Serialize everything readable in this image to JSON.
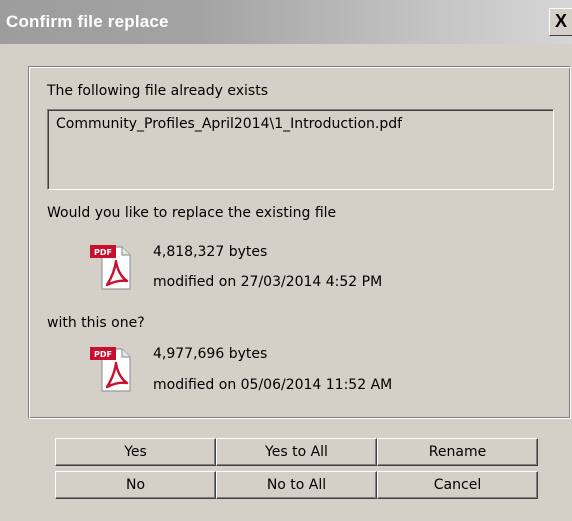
{
  "window": {
    "title": "Confirm file replace",
    "close_glyph": "X"
  },
  "message": {
    "exists_label": "The following file already exists",
    "file_path": "Community_Profiles_April2014\\1_Introduction.pdf",
    "replace_question": "Would you like to replace the existing file",
    "with_label": "with this one?"
  },
  "existing_file": {
    "icon": "pdf-icon",
    "size": "4,818,327 bytes",
    "modified": "modified on 27/03/2014 4:52 PM"
  },
  "new_file": {
    "icon": "pdf-icon",
    "size": "4,977,696 bytes",
    "modified": "modified on 05/06/2014 11:52 AM"
  },
  "buttons": {
    "yes": "Yes",
    "yes_to_all": "Yes to All",
    "rename": "Rename",
    "no": "No",
    "no_to_all": "No to All",
    "cancel": "Cancel"
  },
  "colors": {
    "dialog_bg": "#d4d0c8",
    "pdf_red": "#c8102e"
  }
}
